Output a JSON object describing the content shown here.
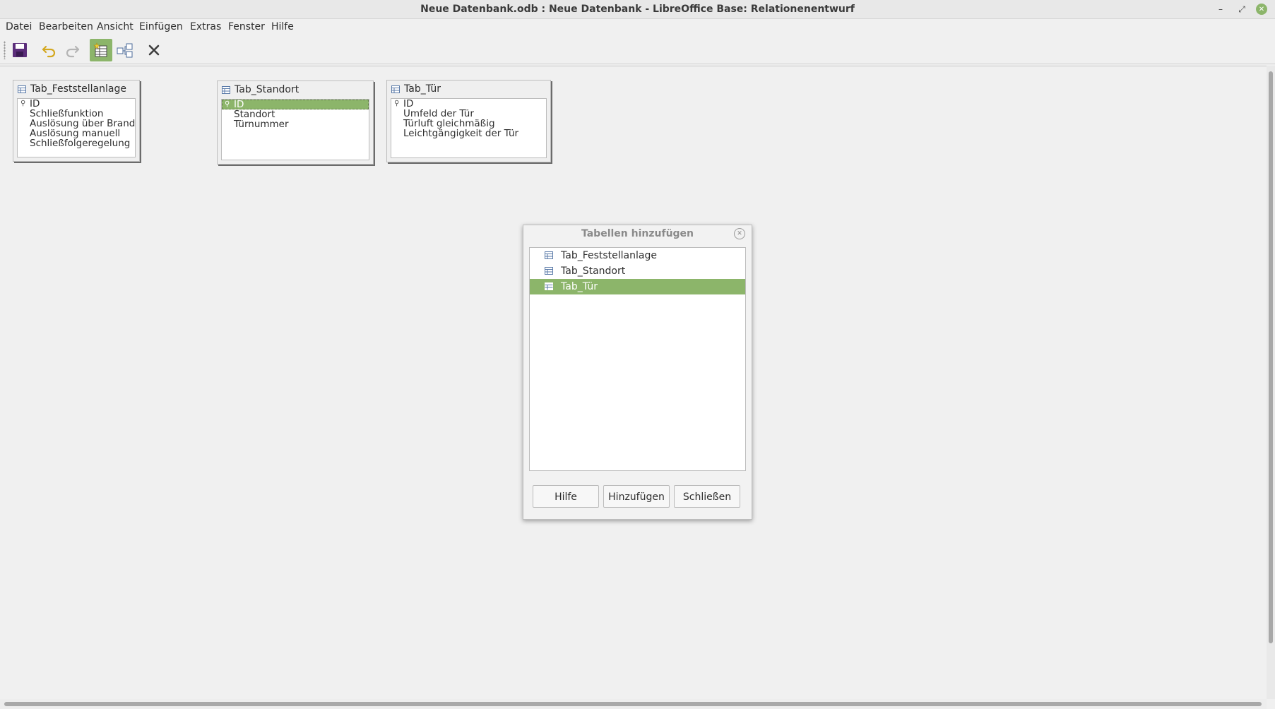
{
  "window": {
    "title": "Neue Datenbank.odb : Neue Datenbank - LibreOffice Base: Relationenentwurf",
    "minimize_glyph": "–",
    "maximize_glyph": "⤢",
    "close_glyph": "✕"
  },
  "menubar": {
    "items": [
      "Datei",
      "Bearbeiten",
      "Ansicht",
      "Einfügen",
      "Extras",
      "Fenster",
      "Hilfe"
    ]
  },
  "toolbar": {
    "buttons": [
      {
        "icon": "save-icon"
      },
      {
        "icon": "undo-icon"
      },
      {
        "icon": "redo-icon"
      },
      {
        "icon": "add-tables-icon",
        "active": true
      },
      {
        "icon": "new-relation-icon"
      },
      {
        "icon": "delete-icon"
      }
    ]
  },
  "tables": [
    {
      "title": "Tab_Feststellanlage",
      "fields": [
        "ID",
        "Schließfunktion",
        "Auslösung über Brandmel",
        "Auslösung manuell",
        "Schließfolgeregelung"
      ],
      "primary_key": "ID"
    },
    {
      "title": "Tab_Standort",
      "fields": [
        "ID",
        "Standort",
        "Türnummer"
      ],
      "primary_key": "ID",
      "selected_field": "ID"
    },
    {
      "title": "Tab_Tür",
      "fields": [
        "ID",
        "Umfeld der Tür",
        "Türluft gleichmäßig",
        "Leichtgängigkeit der Tür"
      ],
      "primary_key": "ID"
    }
  ],
  "dialog": {
    "title": "Tabellen hinzufügen",
    "list": [
      "Tab_Feststellanlage",
      "Tab_Standort",
      "Tab_Tür"
    ],
    "selected": "Tab_Tür",
    "buttons": {
      "help": "Hilfe",
      "add": "Hinzufügen",
      "close": "Schließen"
    },
    "close_glyph": "✕"
  },
  "colors": {
    "accent": "#8cb56a",
    "key_glyph": "⚲"
  }
}
